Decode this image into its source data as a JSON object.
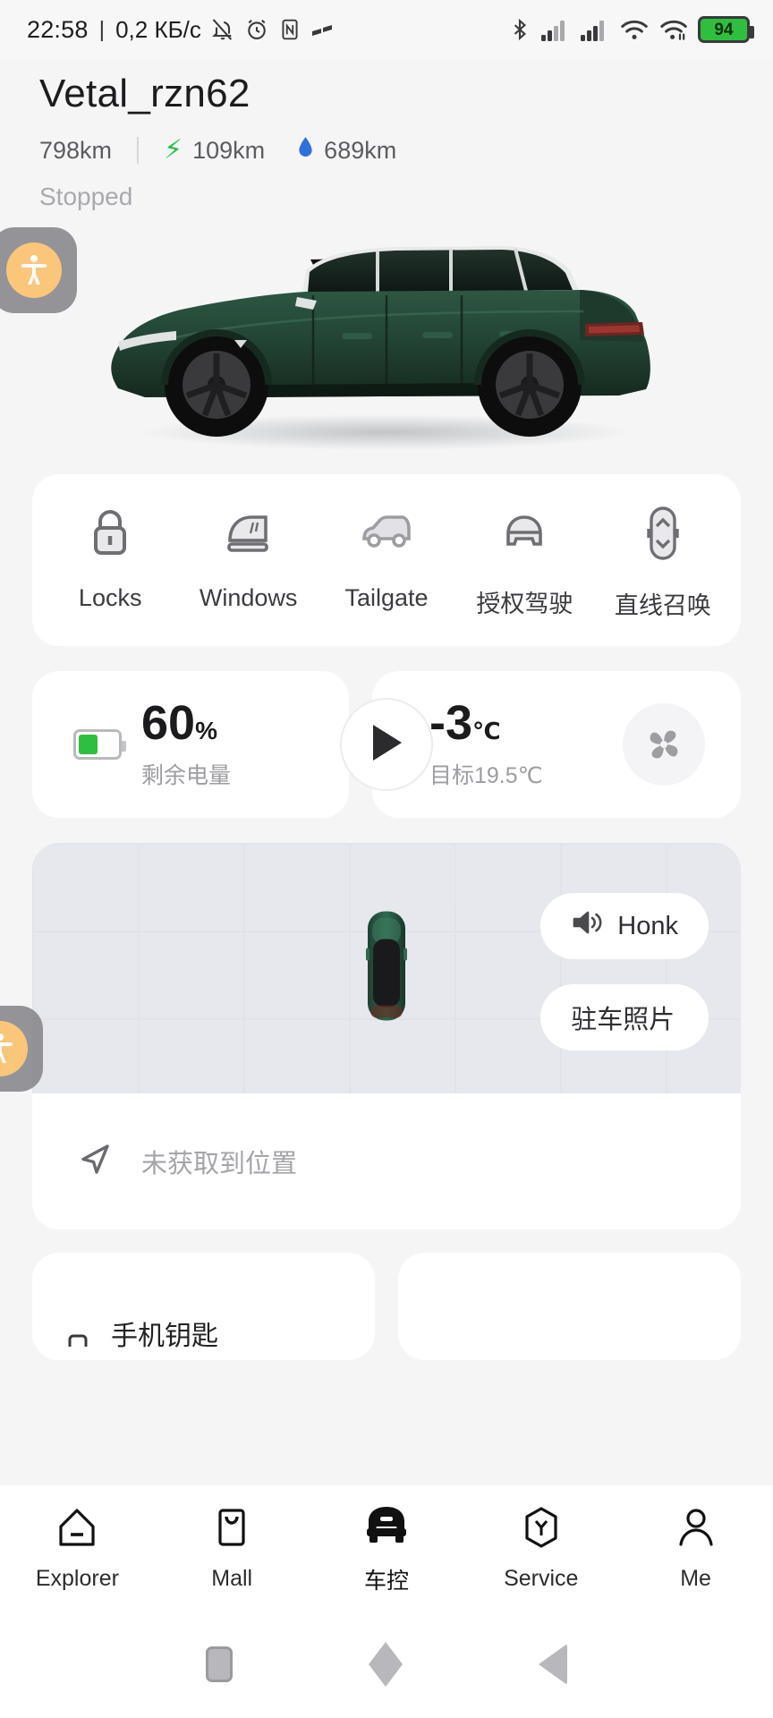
{
  "statusbar": {
    "time": "22:58",
    "separator": "|",
    "network_speed": "0,2 КБ/с",
    "icons": [
      "bell-muted-icon",
      "alarm-clock-icon",
      "nfc-icon",
      "data-saver-icon",
      "bluetooth-icon",
      "signal-sim1-icon",
      "signal-sim2-icon",
      "wifi-icon",
      "wifi-secondary-icon"
    ],
    "battery_percent": "94"
  },
  "header": {
    "car_name": "Vetal_rzn62",
    "total_range": "798km",
    "electric_range": "109km",
    "fuel_range": "689km",
    "vehicle_status": "Stopped"
  },
  "quick_controls": [
    {
      "label": "Locks",
      "icon": "lock-icon"
    },
    {
      "label": "Windows",
      "icon": "window-icon"
    },
    {
      "label": "Tailgate",
      "icon": "tailgate-icon"
    },
    {
      "label": "授权驾驶",
      "icon": "authorized-driving-icon"
    },
    {
      "label": "直线召唤",
      "icon": "straight-summon-icon"
    }
  ],
  "battery_card": {
    "percent": "60",
    "percent_unit": "%",
    "sub_label": "剩余电量",
    "battery_icon": "battery-icon"
  },
  "climate_card": {
    "current_temp": "-3",
    "temp_unit": "℃",
    "target_label": "目标19.5℃",
    "fan_icon": "fan-icon",
    "play_icon": "play-icon"
  },
  "map_card": {
    "car_marker_icon": "car-top-view-icon",
    "actions": [
      {
        "label": "Honk",
        "icon": "speaker-icon"
      },
      {
        "label": "驻车照片",
        "icon": ""
      }
    ],
    "location_icon": "navigation-arrow-icon",
    "location_text": "未获取到位置"
  },
  "partial_cards": [
    {
      "label": "手机钥匙",
      "icon": "phone-key-icon"
    },
    {
      "label": "",
      "icon": ""
    }
  ],
  "bottom_nav": [
    {
      "label": "Explorer",
      "icon": "explorer-icon",
      "active": false
    },
    {
      "label": "Mall",
      "icon": "mall-icon",
      "active": false
    },
    {
      "label": "车控",
      "icon": "car-control-icon",
      "active": true
    },
    {
      "label": "Service",
      "icon": "service-icon",
      "active": false
    },
    {
      "label": "Me",
      "icon": "person-icon",
      "active": false
    }
  ],
  "system_nav": [
    {
      "name": "recents-button",
      "icon": "square-icon"
    },
    {
      "name": "home-button",
      "icon": "diamond-icon"
    },
    {
      "name": "back-button",
      "icon": "triangle-icon"
    }
  ],
  "accessibility_buttons": [
    {
      "icon": "accessibility-icon"
    },
    {
      "icon": "accessibility-icon"
    }
  ],
  "colors": {
    "background": "#f5f5f6",
    "card": "#ffffff",
    "accent_green": "#2fbf3f",
    "fuel_blue": "#2f6fe0",
    "map_bg": "#e7e8ed",
    "car_green": "#234a38"
  }
}
